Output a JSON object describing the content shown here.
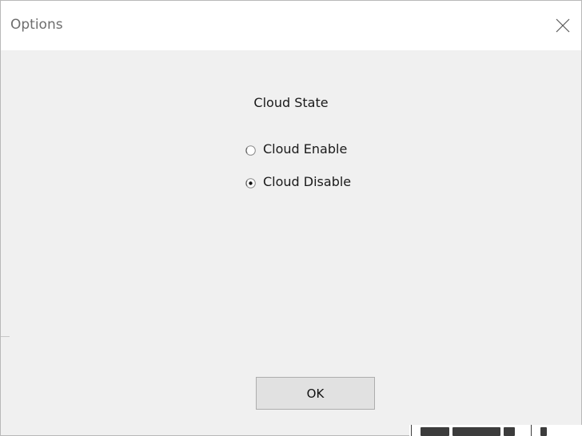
{
  "window": {
    "title": "Options",
    "close_icon": "close-icon"
  },
  "cloud_state": {
    "label": "Cloud State",
    "options": [
      {
        "label": "Cloud Enable",
        "selected": false
      },
      {
        "label": "Cloud Disable",
        "selected": true
      }
    ]
  },
  "footer": {
    "ok_label": "OK"
  },
  "colors": {
    "dialog_bg": "#f0f0f0",
    "titlebar_bg": "#ffffff",
    "button_bg": "#e1e1e1",
    "button_border": "#adadad"
  }
}
